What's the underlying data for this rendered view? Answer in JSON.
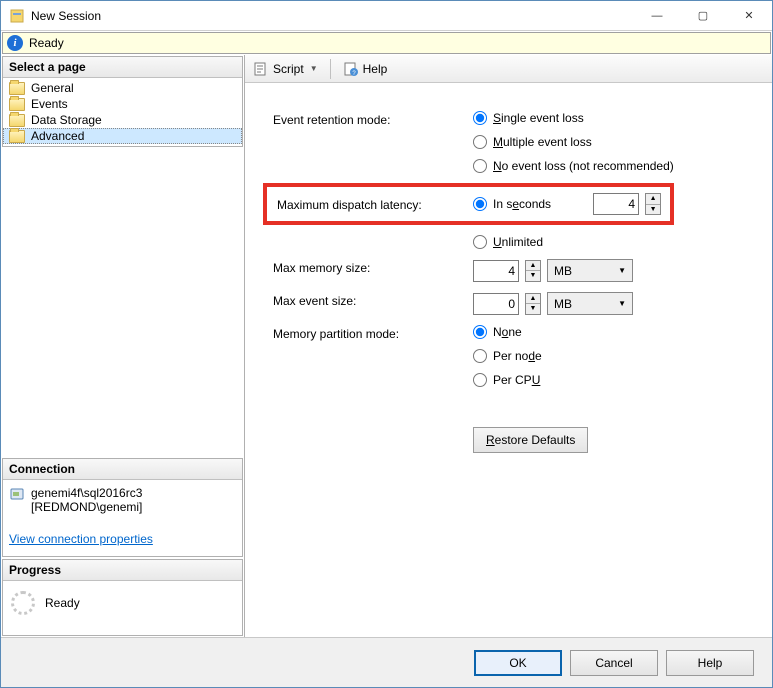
{
  "window": {
    "title": "New Session",
    "minimize": "—",
    "maximize": "▢",
    "close": "✕"
  },
  "status": {
    "text": "Ready"
  },
  "sidebar": {
    "header": "Select a page",
    "items": [
      {
        "label": "General",
        "selected": false
      },
      {
        "label": "Events",
        "selected": false
      },
      {
        "label": "Data Storage",
        "selected": false
      },
      {
        "label": "Advanced",
        "selected": true
      }
    ],
    "connection_header": "Connection",
    "connection_server": "genemi4f\\sql2016rc3",
    "connection_user": "[REDMOND\\genemi]",
    "view_props_link": "View connection properties",
    "progress_header": "Progress",
    "progress_text": "Ready"
  },
  "toolbar": {
    "script": "Script",
    "help": "Help"
  },
  "form": {
    "retention_label": "Event retention mode:",
    "retention_opts": {
      "single_pre": "",
      "single_u": "S",
      "single_post": "ingle event loss",
      "multi_pre": "",
      "multi_u": "M",
      "multi_post": "ultiple event loss",
      "none_pre": "",
      "none_u": "N",
      "none_post": "o event loss (not recommended)"
    },
    "dispatch_label": "Maximum dispatch latency:",
    "dispatch_seconds_pre": "In s",
    "dispatch_seconds_u": "e",
    "dispatch_seconds_post": "conds",
    "dispatch_value": "4",
    "dispatch_unlimited_pre": "",
    "dispatch_unlimited_u": "U",
    "dispatch_unlimited_post": "nlimited",
    "max_mem_label": "Max memory size:",
    "max_mem_value": "4",
    "max_mem_unit": "MB",
    "max_evt_label": "Max event size:",
    "max_evt_value": "0",
    "max_evt_unit": "MB",
    "partition_label": "Memory partition mode:",
    "partition_none_pre": "N",
    "partition_none_u": "o",
    "partition_none_post": "ne",
    "partition_node_pre": "Per no",
    "partition_node_u": "d",
    "partition_node_post": "e",
    "partition_cpu_pre": "Per CP",
    "partition_cpu_u": "U",
    "partition_cpu_post": "",
    "restore_pre": "",
    "restore_u": "R",
    "restore_post": "estore Defaults"
  },
  "footer": {
    "ok": "OK",
    "cancel": "Cancel",
    "help": "Help"
  }
}
